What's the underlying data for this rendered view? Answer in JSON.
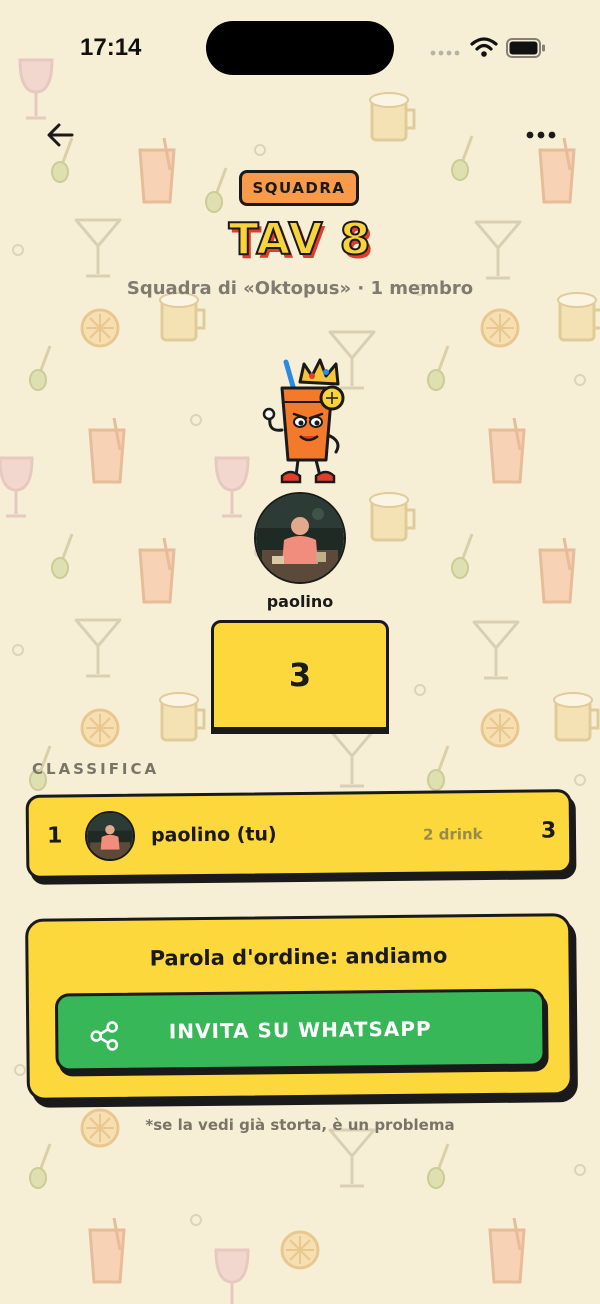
{
  "status_bar": {
    "time": "17:14"
  },
  "header": {
    "badge": "SQUADRA",
    "title": "TAV 8",
    "subtitle": "Squadra di «Oktopus» · 1 membro"
  },
  "podium": {
    "name": "paolino",
    "score": "3"
  },
  "leaderboard": {
    "label": "CLASSIFICA",
    "rows": [
      {
        "position": "1",
        "name": "paolino (tu)",
        "drinks": "2 drink",
        "points": "3"
      }
    ]
  },
  "invite": {
    "password_text": "Parola d'ordine: andiamo",
    "button_label": "INVITA SU WHATSAPP",
    "footnote": "*se la vedi già storta, è un problema"
  },
  "colors": {
    "background": "#f7efd5",
    "accent_yellow": "#fcd83c",
    "badge_orange": "#f79a4a",
    "whatsapp_green": "#37b757",
    "title_shadow_red": "#e23c2a"
  }
}
